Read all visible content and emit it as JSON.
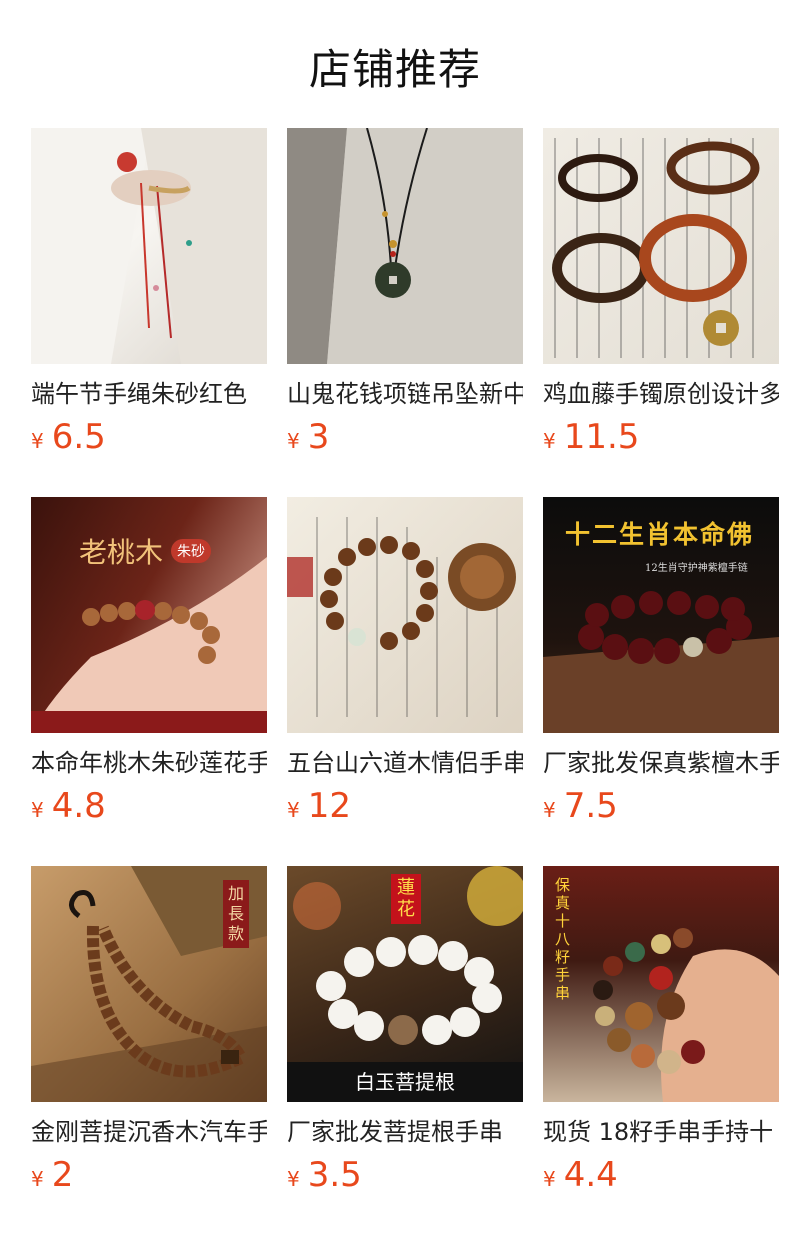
{
  "header": {
    "title": "店铺推荐"
  },
  "products": [
    {
      "title": "端午节手绳朱砂红色",
      "yen": "¥",
      "price": "6.5"
    },
    {
      "title": "山鬼花钱项链吊坠新中",
      "yen": "¥",
      "price": "3"
    },
    {
      "title": "鸡血藤手镯原创设计多",
      "yen": "¥",
      "price": "11.5"
    },
    {
      "title": "本命年桃木朱砂莲花手",
      "yen": "¥",
      "price": "4.8"
    },
    {
      "title": "五台山六道木情侣手串",
      "yen": "¥",
      "price": "12"
    },
    {
      "title": "厂家批发保真紫檀木手",
      "yen": "¥",
      "price": "7.5"
    },
    {
      "title": "金刚菩提沉香木汽车手",
      "yen": "¥",
      "price": "2"
    },
    {
      "title": "厂家批发菩提根手串",
      "yen": "¥",
      "price": "3.5"
    },
    {
      "title": "现货 18籽手串手持十",
      "yen": "¥",
      "price": "4.4"
    }
  ],
  "image_text": {
    "peach": "老桃木",
    "peach_tag": "朱砂",
    "zodiac": "十二生肖本命佛",
    "zodiac_sub": "12生肖守护神紫檀手链",
    "long": "加長款",
    "lotus": "蓮花",
    "bodhi": "白玉菩提根",
    "beads18": "保真十八籽手串"
  }
}
